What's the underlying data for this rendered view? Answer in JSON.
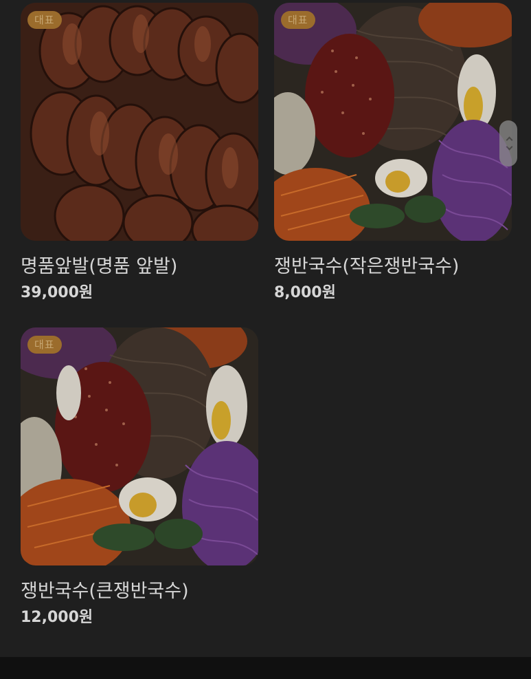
{
  "menu": {
    "items": [
      {
        "badge": "대표",
        "name": "명품앞발(명품 앞발)",
        "price": "39,000원",
        "image": "braised-pork-trotters"
      },
      {
        "badge": "대표",
        "name": "쟁반국수(작은쟁반국수)",
        "price": "8,000원",
        "image": "tray-noodles-small"
      },
      {
        "badge": "대표",
        "name": "쟁반국수(큰쟁반국수)",
        "price": "12,000원",
        "image": "tray-noodles-large"
      }
    ]
  },
  "colors": {
    "background": "#1f1f1f",
    "badge_bg": "#9b6c2c",
    "badge_text": "#c7a773",
    "text": "#d6d6d6"
  }
}
